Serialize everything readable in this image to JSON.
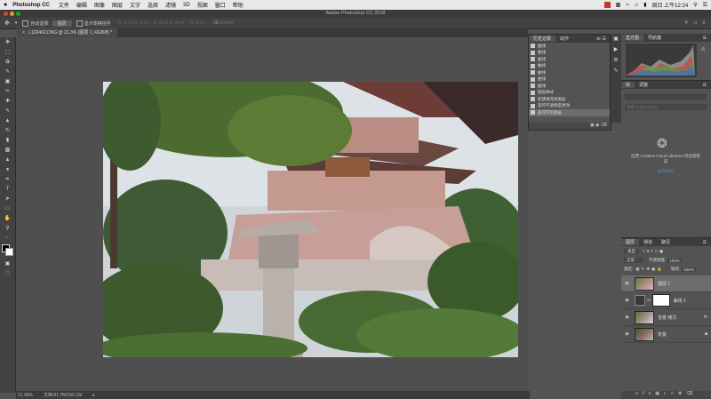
{
  "menubar": {
    "apple": "",
    "app_name": "Photoshop CC",
    "items": [
      "文件",
      "编辑",
      "图像",
      "图层",
      "文字",
      "选择",
      "滤镜",
      "3D",
      "视图",
      "窗口",
      "帮助"
    ],
    "clock": "周日 上午12:24"
  },
  "window": {
    "title": "Adobe Photoshop CC 2018"
  },
  "options": {
    "auto_select_label": "自动选择:",
    "layer_select_value": "图层",
    "transform_label": "显示变换控件"
  },
  "document": {
    "tab_label": "L102462.DNG @ 21.3% (图层 1, RGB/8) *",
    "zoom": "21.46%",
    "doc_size": "文档:81.7M/165.1M"
  },
  "tools": [
    "move-tool",
    "marquee-tool",
    "lasso-tool",
    "quick-select-tool",
    "crop-tool",
    "eyedropper-tool",
    "healing-tool",
    "brush-tool",
    "stamp-tool",
    "history-brush-tool",
    "eraser-tool",
    "gradient-tool",
    "blur-tool",
    "dodge-tool",
    "pen-tool",
    "type-tool",
    "path-select-tool",
    "shape-tool",
    "hand-tool",
    "zoom-tool",
    "more-tool"
  ],
  "history": {
    "tabs": [
      "历史记录",
      "动作"
    ],
    "items": [
      "曲线",
      "曲线",
      "曲线",
      "曲线",
      "曲线",
      "曲线",
      "曲线",
      "图层样式",
      "新建填充色图层",
      "盖印不透明度更改",
      "盖印可见图层"
    ]
  },
  "histogram": {
    "tabs": [
      "直方图",
      "导航器"
    ]
  },
  "libraries": {
    "tabs": [
      "库",
      "调整"
    ],
    "search_placeholder": "搜索 Adobe Stock",
    "message": "启用 Creative Cloud Libraries 时出现错误",
    "retry_link": "再次尝试"
  },
  "layers": {
    "tabs": [
      "图层",
      "通道",
      "路径"
    ],
    "filter_value": "类型",
    "blend_mode": "正常",
    "opacity_label": "不透明度:",
    "opacity_value": "100%",
    "lock_label": "锁定:",
    "fill_label": "填充:",
    "fill_value": "100%",
    "items": [
      {
        "name": "图层 1"
      },
      {
        "name": "曲线 1"
      },
      {
        "name": "背景 拷贝"
      },
      {
        "name": "背景"
      }
    ]
  },
  "colors": {
    "menubar_bg": "#e8e8e8",
    "panel_bg": "#535353",
    "selected_layer": "#6d6d6d",
    "link_blue": "#4a90e2"
  }
}
